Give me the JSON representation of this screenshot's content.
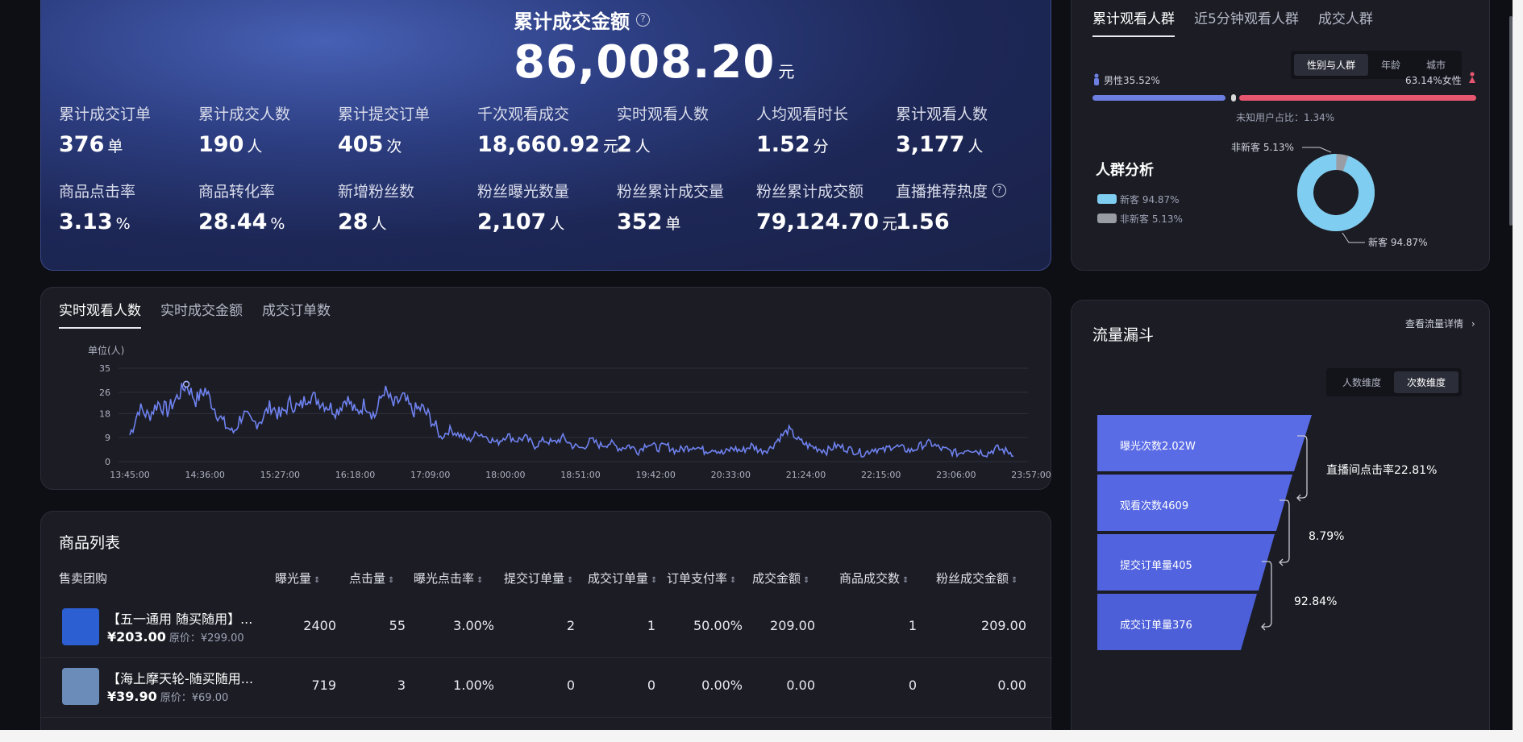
{
  "summary": {
    "total_label": "累计成交金额",
    "total_value": "86,008.20",
    "total_unit": "元",
    "metrics_row1": [
      {
        "label": "累计成交订单",
        "value": "376",
        "unit": "单"
      },
      {
        "label": "累计成交人数",
        "value": "190",
        "unit": "人"
      },
      {
        "label": "累计提交订单",
        "value": "405",
        "unit": "次"
      },
      {
        "label": "千次观看成交",
        "value": "18,660.92",
        "unit": "元"
      },
      {
        "label": "实时观看人数",
        "value": "2",
        "unit": "人"
      },
      {
        "label": "人均观看时长",
        "value": "1.52",
        "unit": "分"
      },
      {
        "label": "累计观看人数",
        "value": "3,177",
        "unit": "人"
      }
    ],
    "metrics_row2": [
      {
        "label": "商品点击率",
        "value": "3.13",
        "unit": "%"
      },
      {
        "label": "商品转化率",
        "value": "28.44",
        "unit": "%"
      },
      {
        "label": "新增粉丝数",
        "value": "28",
        "unit": "人"
      },
      {
        "label": "粉丝曝光数量",
        "value": "2,107",
        "unit": "人"
      },
      {
        "label": "粉丝累计成交量",
        "value": "352",
        "unit": "单"
      },
      {
        "label": "粉丝累计成交额",
        "value": "79,124.70",
        "unit": "元"
      },
      {
        "label": "直播推荐热度",
        "value": "1.56",
        "unit": ""
      }
    ]
  },
  "realtime": {
    "tabs": [
      "实时观看人数",
      "实时成交金额",
      "成交订单数"
    ],
    "active_tab": 0
  },
  "chart_data": {
    "type": "line",
    "ylabel": "单位(人)",
    "yticks": [
      0,
      9,
      18,
      26,
      35
    ],
    "ylim": [
      0,
      35
    ],
    "xticks": [
      "13:45:00",
      "14:36:00",
      "15:27:00",
      "16:18:00",
      "17:09:00",
      "18:00:00",
      "18:51:00",
      "19:42:00",
      "20:33:00",
      "21:24:00",
      "22:15:00",
      "23:06:00",
      "23:57:00"
    ],
    "series": [
      {
        "name": "",
        "color": "#6f82f0",
        "values": [
          10,
          20,
          17,
          22,
          19,
          24,
          29,
          23,
          27,
          20,
          14,
          11,
          18,
          14,
          16,
          21,
          17,
          22,
          20,
          25,
          23,
          21,
          19,
          24,
          18,
          22,
          17,
          27,
          21,
          24,
          19,
          20,
          16,
          9,
          12,
          10,
          8,
          11,
          9,
          7,
          10,
          8,
          9,
          6,
          8,
          7,
          9,
          6,
          5,
          8,
          6,
          7,
          5,
          6,
          4,
          7,
          5,
          6,
          4,
          5,
          6,
          4,
          5,
          3,
          5,
          4,
          6,
          4,
          5,
          9,
          12,
          8,
          6,
          5,
          4,
          6,
          5,
          4,
          3,
          5,
          4,
          6,
          5,
          4,
          6,
          7,
          5,
          4,
          3,
          5,
          4,
          3,
          5,
          4,
          3
        ]
      }
    ],
    "marker_point": {
      "x": "14:05",
      "y": 29
    }
  },
  "products": {
    "title": "商品列表",
    "columns": [
      "售卖团购",
      "曝光量",
      "点击量",
      "曝光点击率",
      "提交订单量",
      "成交订单量",
      "订单支付率",
      "成交金额",
      "商品成交数",
      "粉丝成交金额"
    ],
    "rows": [
      {
        "name": "【五一通用 随买随用】...",
        "price": "¥203.00",
        "orig": "原价：¥299.00",
        "exposure": "2400",
        "clicks": "55",
        "ctr": "3.00%",
        "submitted": "2",
        "completed": "1",
        "pay_rate": "50.00%",
        "amount": "209.00",
        "items_sold": "1",
        "fan_amount": "209.00"
      },
      {
        "name": "【海上摩天轮-随买随用...",
        "price": "¥39.90",
        "orig": "原价：¥69.00",
        "exposure": "719",
        "clicks": "3",
        "ctr": "1.00%",
        "submitted": "0",
        "completed": "0",
        "pay_rate": "0.00%",
        "amount": "0.00",
        "items_sold": "0",
        "fan_amount": "0.00"
      }
    ]
  },
  "audience": {
    "tabs": [
      "累计观看人群",
      "近5分钟观看人群",
      "成交人群"
    ],
    "segments": [
      "性别与人群",
      "年龄",
      "城市"
    ],
    "male_label": "男性35.52%",
    "female_label": "63.14%女性",
    "unknown_label": "未知用户占比：1.34%",
    "crowd_title": "人群分析",
    "legend_new": "新客 94.87%",
    "legend_old": "非新客 5.13%",
    "donut_old_label": "非新客 5.13%",
    "donut_new_label": "新客 94.87%",
    "male_pct": 35.52,
    "female_pct": 63.14,
    "unknown_pct": 1.34,
    "new_pct": 94.87,
    "old_pct": 5.13,
    "colors": {
      "male": "#6c7fe0",
      "female": "#e6566f",
      "new": "#7fcdf0",
      "old": "#9a9ca4"
    }
  },
  "funnel": {
    "title": "流量漏斗",
    "link": "查看流量详情",
    "segments": [
      "人数维度",
      "次数维度"
    ],
    "steps": [
      "曝光次数2.02W",
      "观看次数4609",
      "提交订单量405",
      "成交订单量376"
    ],
    "conversions": [
      "直播间点击率22.81%",
      "8.79%",
      "92.84%"
    ]
  }
}
